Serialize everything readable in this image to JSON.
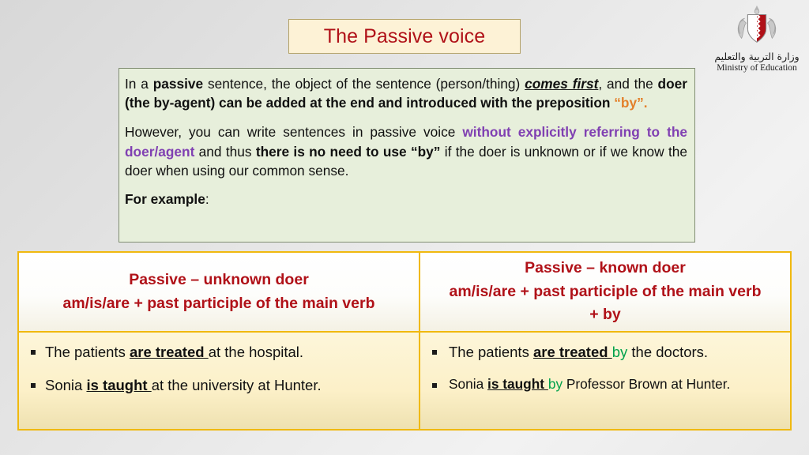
{
  "slide": {
    "title": "The Passive voice",
    "logo": {
      "icon": "bahrain-coat-of-arms",
      "arabic": "وزارة التربية والتعليم",
      "english": "Ministry of Education"
    },
    "explanation": {
      "paragraph1": {
        "segments": [
          {
            "text": "In  a ",
            "style": "normal"
          },
          {
            "text": "passive",
            "style": "bold"
          },
          {
            "text": " sentence,  the  object  of  the  sentence  (person/thing)  ",
            "style": "normal"
          },
          {
            "text": "comes first",
            "style": "bold-italic-underline"
          },
          {
            "text": ", and the ",
            "style": "normal"
          },
          {
            "text": "doer (the by-agent) can be added at the end and introduced with the preposition ",
            "style": "bold"
          },
          {
            "text": "“by”.",
            "style": "orange-bold"
          }
        ],
        "plain": "In a passive sentence, the object of the sentence (person/thing) comes first, and the doer (the by-agent) can be added at the end and introduced with the preposition “by”."
      },
      "paragraph2": {
        "segments": [
          {
            "text": "However,  you  can  write  sentences  in  passive  voice  ",
            "style": "normal"
          },
          {
            "text": "without explicitly referring to the doer/agent",
            "style": "purple-bold"
          },
          {
            "text": " and thus ",
            "style": "normal"
          },
          {
            "text": "there is no need to use “by”",
            "style": "bold"
          },
          {
            "text": " if the doer is unknown or if we know the doer when using our common sense.",
            "style": "normal"
          }
        ],
        "plain": "However, you can write sentences in passive voice without explicitly referring to the doer/agent and thus there is no need to use “by” if the doer is unknown or if we know the doer when using our common sense."
      },
      "for_example": "For example",
      "for_example_colon": ":"
    },
    "table": {
      "columns": [
        {
          "header_lines": [
            "Passive – unknown doer",
            "am/is/are + past participle of the main verb"
          ],
          "examples": [
            {
              "before": "The patients ",
              "verb": "are treated ",
              "after": "at the hospital.",
              "by": "",
              "tail": ""
            },
            {
              "before": "Sonia ",
              "verb": "is taught ",
              "after": "at the university at Hunter.",
              "by": "",
              "tail": ""
            }
          ]
        },
        {
          "header_lines": [
            "Passive – known doer",
            "am/is/are + past participle of the main verb",
            "+ by"
          ],
          "examples": [
            {
              "before": "The patients ",
              "verb": "are treated ",
              "by": "by",
              "after": " the doctors.",
              "tail": ""
            },
            {
              "before": "Sonia ",
              "verb": "is taught ",
              "by": "by",
              "after": " Professor Brown at Hunter.",
              "tail": ""
            }
          ]
        }
      ]
    },
    "colors": {
      "title_text": "#b01118",
      "header_text": "#b01118",
      "explain_bg": "#e7efdb",
      "explain_border": "#818e73",
      "title_bg": "#fdf2d6",
      "title_border": "#b3a268",
      "table_border": "#f0b90f",
      "body_bg": "#fcf0c8",
      "orange": "#e3802b",
      "purple": "#8040b2",
      "green": "#00a14b",
      "slide_bg": "#e6e6e6"
    }
  }
}
